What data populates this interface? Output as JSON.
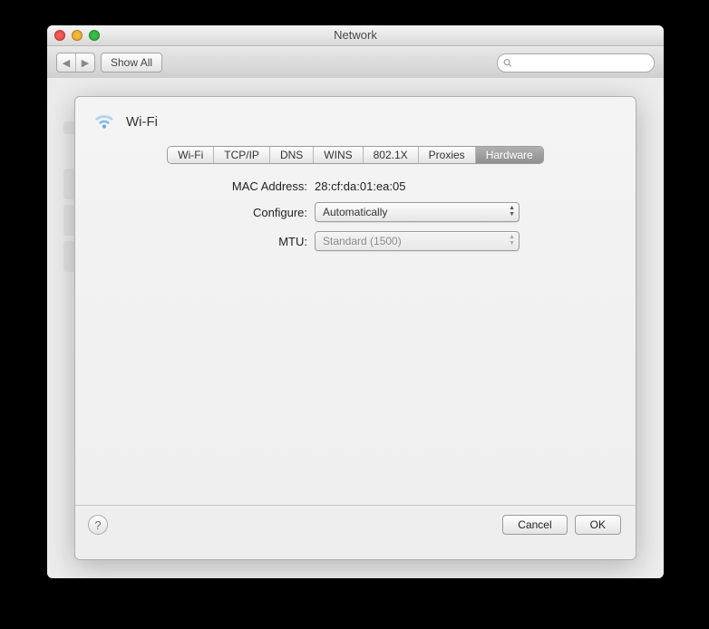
{
  "window": {
    "title": "Network"
  },
  "toolbar": {
    "show_all": "Show All",
    "search_placeholder": ""
  },
  "panel": {
    "title": "Wi-Fi"
  },
  "tabs": {
    "wifi": "Wi-Fi",
    "tcpip": "TCP/IP",
    "dns": "DNS",
    "wins": "WINS",
    "dot1x": "802.1X",
    "proxies": "Proxies",
    "hardware": "Hardware"
  },
  "form": {
    "mac_label": "MAC Address:",
    "mac_value": "28:cf:da:01:ea:05",
    "configure_label": "Configure:",
    "configure_value": "Automatically",
    "mtu_label": "MTU:",
    "mtu_value": "Standard  (1500)"
  },
  "footer": {
    "help": "?",
    "cancel": "Cancel",
    "ok": "OK"
  }
}
